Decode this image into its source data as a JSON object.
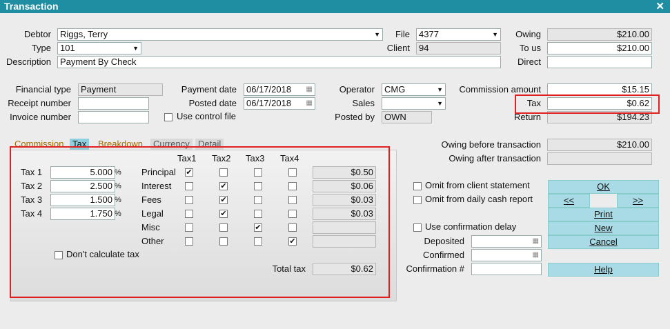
{
  "window": {
    "title": "Transaction"
  },
  "debtor": {
    "label": "Debtor",
    "value": "Riggs, Terry"
  },
  "type": {
    "label": "Type",
    "value": "101"
  },
  "description": {
    "label": "Description",
    "value": "Payment By Check"
  },
  "file": {
    "label": "File",
    "value": "4377"
  },
  "client": {
    "label": "Client",
    "value": "94"
  },
  "owing": {
    "label": "Owing",
    "value": "$210.00"
  },
  "to_us": {
    "label": "To us",
    "value": "$210.00"
  },
  "direct": {
    "label": "Direct",
    "value": ""
  },
  "financial_type": {
    "label": "Financial type",
    "value": "Payment"
  },
  "receipt_number": {
    "label": "Receipt number",
    "value": ""
  },
  "invoice_number": {
    "label": "Invoice number",
    "value": ""
  },
  "payment_date": {
    "label": "Payment date",
    "value": "06/17/2018"
  },
  "posted_date": {
    "label": "Posted date",
    "value": "06/17/2018"
  },
  "use_control_file": {
    "label": "Use control file",
    "checked": false
  },
  "operator": {
    "label": "Operator",
    "value": "CMG"
  },
  "sales": {
    "label": "Sales",
    "value": ""
  },
  "posted_by": {
    "label": "Posted by",
    "value": "OWN"
  },
  "commission_amount": {
    "label": "Commission amount",
    "value": "$15.15"
  },
  "tax": {
    "label": "Tax",
    "value": "$0.62"
  },
  "return": {
    "label": "Return",
    "value": "$194.23"
  },
  "tabs": [
    {
      "label": "Commission",
      "active": false
    },
    {
      "label": "Tax",
      "active": true
    },
    {
      "label": "Breakdown",
      "active": false
    },
    {
      "label": "Currency",
      "active": false
    },
    {
      "label": "Detail",
      "active": false
    }
  ],
  "tax_panel": {
    "column_headers": [
      "Tax1",
      "Tax2",
      "Tax3",
      "Tax4"
    ],
    "rates": [
      {
        "label": "Tax 1",
        "value": "5.000",
        "unit": "%"
      },
      {
        "label": "Tax 2",
        "value": "2.500",
        "unit": "%"
      },
      {
        "label": "Tax 3",
        "value": "1.500",
        "unit": "%"
      },
      {
        "label": "Tax 4",
        "value": "1.750",
        "unit": "%"
      }
    ],
    "rows": [
      {
        "label": "Principal",
        "checks": [
          true,
          false,
          false,
          false
        ],
        "amount": "$0.50"
      },
      {
        "label": "Interest",
        "checks": [
          false,
          true,
          false,
          false
        ],
        "amount": "$0.06"
      },
      {
        "label": "Fees",
        "checks": [
          false,
          true,
          false,
          false
        ],
        "amount": "$0.03"
      },
      {
        "label": "Legal",
        "checks": [
          false,
          true,
          false,
          false
        ],
        "amount": "$0.03"
      },
      {
        "label": "Misc",
        "checks": [
          false,
          false,
          true,
          false
        ],
        "amount": ""
      },
      {
        "label": "Other",
        "checks": [
          false,
          false,
          false,
          true
        ],
        "amount": ""
      }
    ],
    "dont_calculate": {
      "label": "Don't calculate tax",
      "checked": false
    },
    "total_tax": {
      "label": "Total tax",
      "value": "$0.62"
    }
  },
  "owing_before": {
    "label": "Owing before transaction",
    "value": "$210.00"
  },
  "owing_after": {
    "label": "Owing after transaction",
    "value": ""
  },
  "omit_client_statement": {
    "label": "Omit from client statement",
    "checked": false
  },
  "omit_daily_cash": {
    "label": "Omit from daily cash report",
    "checked": false
  },
  "use_confirmation_delay": {
    "label": "Use confirmation delay",
    "checked": false
  },
  "deposited": {
    "label": "Deposited",
    "value": ""
  },
  "confirmed": {
    "label": "Confirmed",
    "value": ""
  },
  "confirmation_number": {
    "label": "Confirmation #",
    "value": ""
  },
  "buttons": {
    "ok": "OK",
    "prev": "<<",
    "next": ">>",
    "print": "Print",
    "new": "New",
    "cancel": "Cancel",
    "help": "Help"
  },
  "colors": {
    "titlebar": "#1f8ea3",
    "button": "#a9dbe6",
    "highlight": "#e02020"
  }
}
